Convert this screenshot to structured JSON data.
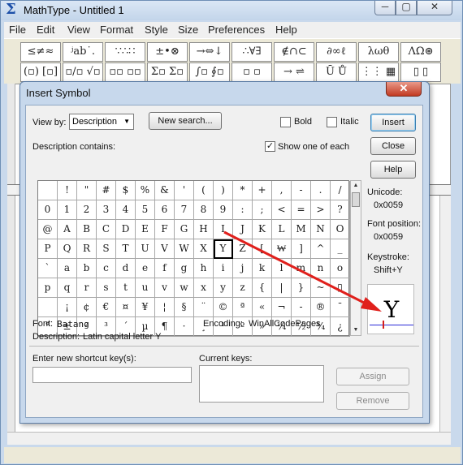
{
  "window": {
    "app_icon": "Σ",
    "title": "MathType - Untitled 1",
    "min_glyph": "─",
    "max_glyph": "▢",
    "close_glyph": "✕"
  },
  "menu": [
    "File",
    "Edit",
    "View",
    "Format",
    "Style",
    "Size",
    "Preferences",
    "Help"
  ],
  "palette_row1": [
    "≤≠≈",
    "ʲab˙.",
    "∵∴∷",
    "±•⊗",
    "→⇔↓",
    "∴∀∃",
    "∉∩⊂",
    "∂∞ℓ",
    "λωθ",
    "ΛΩ⊛"
  ],
  "palette_row2": [
    "(▫) [▫]",
    "▫/▫ √▫",
    "▫▫ ▫▫",
    "Σ▫ Σ▫",
    "∫▫ ∮▫",
    "▫ ▫",
    "→ ⇌",
    "Ū Ů",
    "⋮⋮ ▦",
    "▯ ▯"
  ],
  "dialog": {
    "title": "Insert Symbol",
    "close_glyph": "✕",
    "view_by_label": "View by:",
    "view_by_value": "Description",
    "new_search_label": "New search...",
    "bold_label": "Bold",
    "bold_checked": false,
    "italic_label": "Italic",
    "italic_checked": false,
    "insert_label": "Insert",
    "close_label": "Close",
    "help_label": "Help",
    "desc_contains_label": "Description contains:",
    "show_one_label": "Show one of each",
    "show_one_checked": true,
    "checkmark": "✓",
    "unicode_label": "Unicode:",
    "unicode_value": "0x0059",
    "font_position_label": "Font position:",
    "font_position_value": "0x0059",
    "keystroke_label": "Keystroke:",
    "keystroke_value": "Shift+Y",
    "preview_glyph": "Y",
    "font_label": "Font:",
    "font_value": "Batang",
    "encoding_label": "Encoding:",
    "encoding_value": "WinAllCodePages",
    "description_label": "Description:",
    "description_value": "Latin capital letter Y",
    "shortcut_label": "Enter new shortcut key(s):",
    "current_keys_label": "Current keys:",
    "assign_label": "Assign",
    "remove_label": "Remove",
    "selected_cell": [
      3,
      9
    ]
  },
  "symbol_grid": [
    [
      "",
      "!",
      "\"",
      "#",
      "$",
      "%",
      "&",
      "'",
      "(",
      ")",
      "*",
      "+",
      ",",
      "-",
      ".",
      "/"
    ],
    [
      "0",
      "1",
      "2",
      "3",
      "4",
      "5",
      "6",
      "7",
      "8",
      "9",
      ":",
      ";",
      "<",
      "=",
      ">",
      "?"
    ],
    [
      "@",
      "A",
      "B",
      "C",
      "D",
      "E",
      "F",
      "G",
      "H",
      "I",
      "J",
      "K",
      "L",
      "M",
      "N",
      "O"
    ],
    [
      "P",
      "Q",
      "R",
      "S",
      "T",
      "U",
      "V",
      "W",
      "X",
      "Y",
      "Z",
      "[",
      "₩",
      "]",
      "^",
      "_"
    ],
    [
      "`",
      "a",
      "b",
      "c",
      "d",
      "e",
      "f",
      "g",
      "h",
      "i",
      "j",
      "k",
      "l",
      "m",
      "n",
      "o"
    ],
    [
      "p",
      "q",
      "r",
      "s",
      "t",
      "u",
      "v",
      "w",
      "x",
      "y",
      "z",
      "{",
      "|",
      "}",
      "~",
      "▯"
    ],
    [
      "",
      "¡",
      "¢",
      "€",
      "¤",
      "¥",
      "¦",
      "§",
      "¨",
      "©",
      "ª",
      "«",
      "¬",
      "-",
      "®",
      "¯"
    ],
    [
      "°",
      "±",
      "²",
      "³",
      "´",
      "µ",
      "¶",
      "·",
      "¸",
      "¹",
      "º",
      "»",
      "¼",
      "½",
      "¾",
      "¿"
    ]
  ],
  "colors": {
    "annotation_arrow": "#e0201c"
  }
}
